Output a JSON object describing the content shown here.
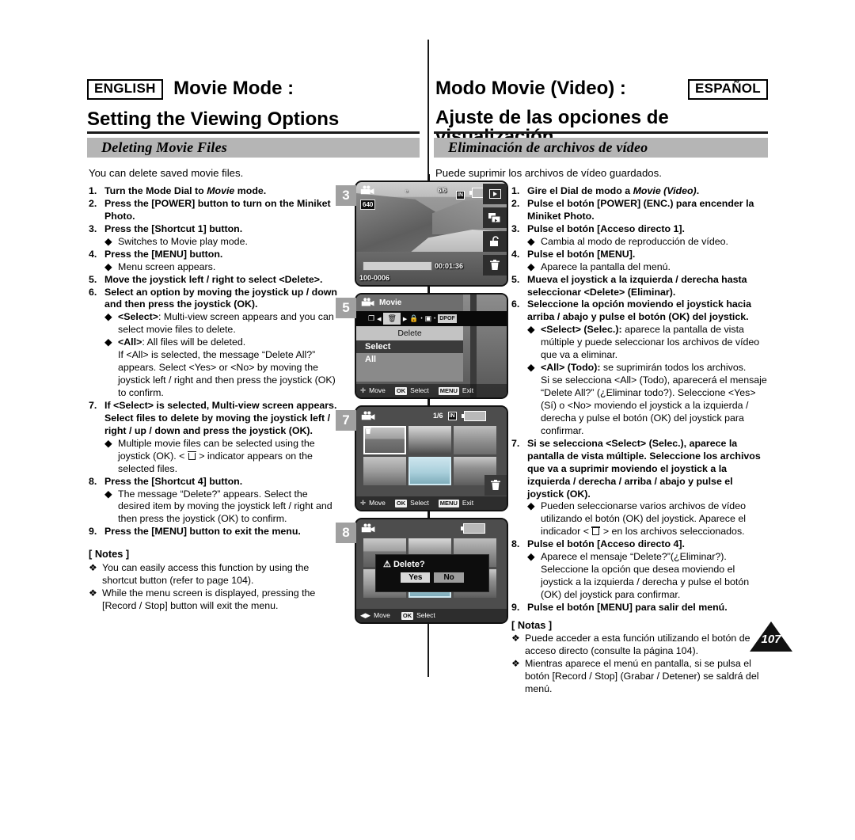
{
  "header": {
    "english": {
      "lang_badge": "ENGLISH",
      "title": "Movie Mode :",
      "subtitle": "Setting the Viewing Options",
      "section": "Deleting Movie Files"
    },
    "spanish": {
      "lang_badge": "ESPAÑOL",
      "title": "Modo Movie (Video) :",
      "subtitle": "Ajuste de las opciones de visualización",
      "section": "Eliminación de archivos de vídeo"
    }
  },
  "english": {
    "intro": "You can delete saved movie files.",
    "steps": [
      {
        "num": "1.",
        "text": "Turn the Mode Dial to Movie mode.",
        "italic_word": "Movie"
      },
      {
        "num": "2.",
        "text": "Press the [POWER] button to turn on the Miniket Photo."
      },
      {
        "num": "3.",
        "text": "Press the [Shortcut 1] button.",
        "bullets": [
          "Switches to Movie play mode."
        ]
      },
      {
        "num": "4.",
        "text": "Press the [MENU] button.",
        "bullets": [
          "Menu screen appears."
        ]
      },
      {
        "num": "5.",
        "text": "Move the joystick left / right to select <Delete>."
      },
      {
        "num": "6.",
        "text": "Select an option by moving the joystick up / down and then press the joystick (OK)."
      },
      {
        "num": "7.",
        "text": "If <Select> is selected, Multi-view screen appears. Select files to delete by moving the joystick left / right / up / down and press the joystick (OK)."
      },
      {
        "num": "8.",
        "text": "Press the [Shortcut 4] button."
      },
      {
        "num": "9.",
        "text": "Press the [MENU] button to exit the menu."
      }
    ],
    "b6_select_label": "<Select>",
    "b6_select_rest": ": Multi-view screen appears and you can select movie files to delete.",
    "b6_all_label": "<All>",
    "b6_all_rest": ": All files will be deleted.",
    "b6_all_cont": "If <All> is selected, the message “Delete All?” appears. Select <Yes> or <No> by moving the joystick left / right and then press the joystick (OK) to confirm.",
    "b7_text_a": "Multiple movie files can be selected using the joystick (OK). < ",
    "b7_text_b": " > indicator appears on the selected files.",
    "b8_text": "The message “Delete?” appears. Select the desired item by moving the joystick left / right and then press the joystick (OK) to confirm.",
    "notes_title": "[ Notes ]",
    "notes": [
      "You can easily access this function by using the shortcut button (refer to page 104).",
      "While the menu screen is displayed, pressing the [Record / Stop] button will exit the menu."
    ]
  },
  "spanish": {
    "intro": "Puede suprimir los archivos de vídeo guardados.",
    "steps": [
      {
        "num": "1.",
        "text": "Gire el Dial de modo a Movie (Video).",
        "italic_word": "Movie (Video)"
      },
      {
        "num": "2.",
        "text": "Pulse el botón [POWER] (ENC.) para encender la Miniket Photo."
      },
      {
        "num": "3.",
        "text": "Pulse el botón [Acceso directo 1].",
        "bullets": [
          "Cambia al modo de reproducción de vídeo."
        ]
      },
      {
        "num": "4.",
        "text": "Pulse el botón [MENU].",
        "bullets": [
          "Aparece la pantalla del menú."
        ]
      },
      {
        "num": "5.",
        "text": "Mueva el joystick a la izquierda / derecha hasta seleccionar <Delete> (Eliminar)."
      },
      {
        "num": "6.",
        "text": "Seleccione la opción moviendo el joystick hacia arriba / abajo y pulse el botón (OK) del joystick."
      },
      {
        "num": "7.",
        "text": "Si se selecciona <Select> (Selec.), aparece la pantalla de vista múltiple. Seleccione los archivos que va a suprimir moviendo el joystick a la izquierda / derecha / arriba / abajo y pulse el joystick (OK)."
      },
      {
        "num": "8.",
        "text": "Pulse el botón [Acceso directo 4]."
      },
      {
        "num": "9.",
        "text": "Pulse el botón [MENU] para salir del menú."
      }
    ],
    "b6_select_label": "<Select> (Selec.):",
    "b6_select_rest": " aparece la pantalla de vista múltiple y puede seleccionar los archivos de vídeo que va a eliminar.",
    "b6_all_label": "<All> (Todo):",
    "b6_all_rest": " se suprimirán todos los archivos.",
    "b6_all_cont": "Si se selecciona <All> (Todo), aparecerá el mensaje “Delete All?” (¿Eliminar todo?). Seleccione <Yes> (Sí) o <No> moviendo el joystick a la izquierda / derecha y pulse el botón (OK) del joystick para confirmar.",
    "b7_text_a": "Pueden seleccionarse varios archivos de vídeo utilizando el botón (OK) del joystick. Aparece el indicador < ",
    "b7_text_b": " > en los archivos seleccionados.",
    "b8_text": "Aparece el mensaje “Delete?”(¿Eliminar?). Seleccione la opción que desea moviendo el joystick a la izquierda / derecha y pulse el botón (OK) del joystick para confirmar.",
    "notes_title": "[ Notas ]",
    "notes": [
      "Puede acceder a esta función utilizando el botón de acceso directo (consulte la página 104).",
      "Mientras aparece el menú en pantalla, si se pulsa el botón [Record / Stop] (Grabar / Detener) se saldrá del menú."
    ]
  },
  "screens": [
    {
      "badge": "3",
      "name": "movie-play-screen",
      "counter": "6/6",
      "memory": "IN",
      "resolution": "640",
      "timecode": "00:01:36",
      "filename": "100-0006",
      "side_buttons": [
        "play-icon",
        "multiview-icon",
        "lock-icon",
        "trash-icon"
      ]
    },
    {
      "badge": "5",
      "name": "delete-menu-screen",
      "menu_title": "Movie",
      "tab_label": "Delete",
      "options": [
        "Select",
        "All"
      ],
      "selected_option": "Select",
      "footer": [
        {
          "key": "joystick",
          "label": "Move"
        },
        {
          "key": "OK",
          "label": "Select"
        },
        {
          "key": "MENU",
          "label": "Exit"
        }
      ]
    },
    {
      "badge": "7",
      "name": "multiview-select-screen",
      "counter": "1/6",
      "memory": "IN",
      "footer": [
        {
          "key": "joystick",
          "label": "Move"
        },
        {
          "key": "OK",
          "label": "Select"
        },
        {
          "key": "MENU",
          "label": "Exit"
        }
      ]
    },
    {
      "badge": "8",
      "name": "delete-confirm-screen",
      "dialog_title": "Delete?",
      "dialog_yes": "Yes",
      "dialog_no": "No",
      "footer": [
        {
          "key": "joystick",
          "label": "Move"
        },
        {
          "key": "OK",
          "label": "Select"
        }
      ]
    }
  ],
  "page_number": "107",
  "colors": {
    "band": "#b5b5b5",
    "badge": "#a0a0a0",
    "rule": "#1a1a1a"
  }
}
